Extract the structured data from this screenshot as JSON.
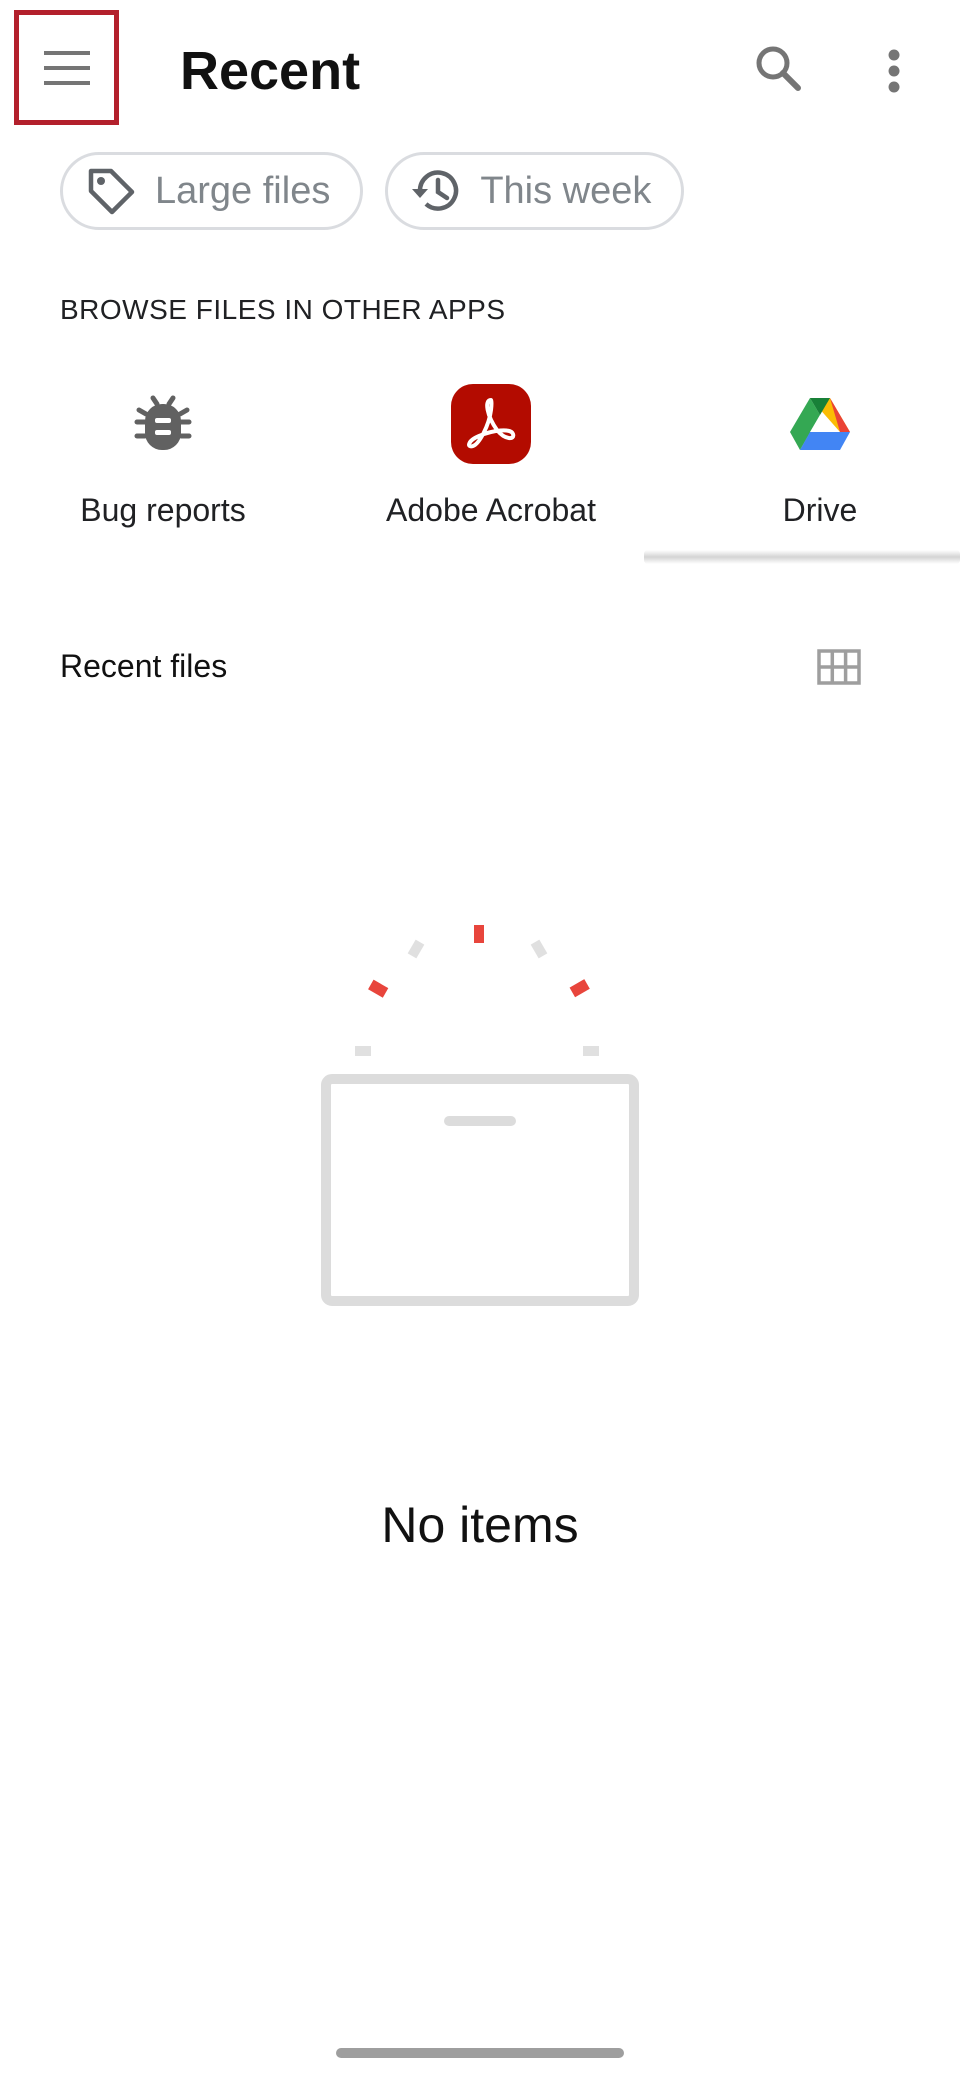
{
  "header": {
    "title": "Recent",
    "menu_icon": "hamburger-menu-icon",
    "search_icon": "search-icon",
    "more_icon": "more-vert-icon",
    "highlight_color": "#b3202c"
  },
  "filter_chips": [
    {
      "label": "Large files",
      "icon": "tag-icon"
    },
    {
      "label": "This week",
      "icon": "history-icon"
    }
  ],
  "browse_section": {
    "title": "BROWSE FILES IN OTHER APPS",
    "apps": [
      {
        "label": "Bug reports",
        "icon": "bug-icon"
      },
      {
        "label": "Adobe Acrobat",
        "icon": "adobe-acrobat-icon",
        "color": "#b30b00"
      },
      {
        "label": "Drive",
        "icon": "google-drive-icon"
      }
    ]
  },
  "recent_files": {
    "title": "Recent files",
    "view_toggle_icon": "grid-view-icon",
    "empty_state_text": "No items"
  }
}
